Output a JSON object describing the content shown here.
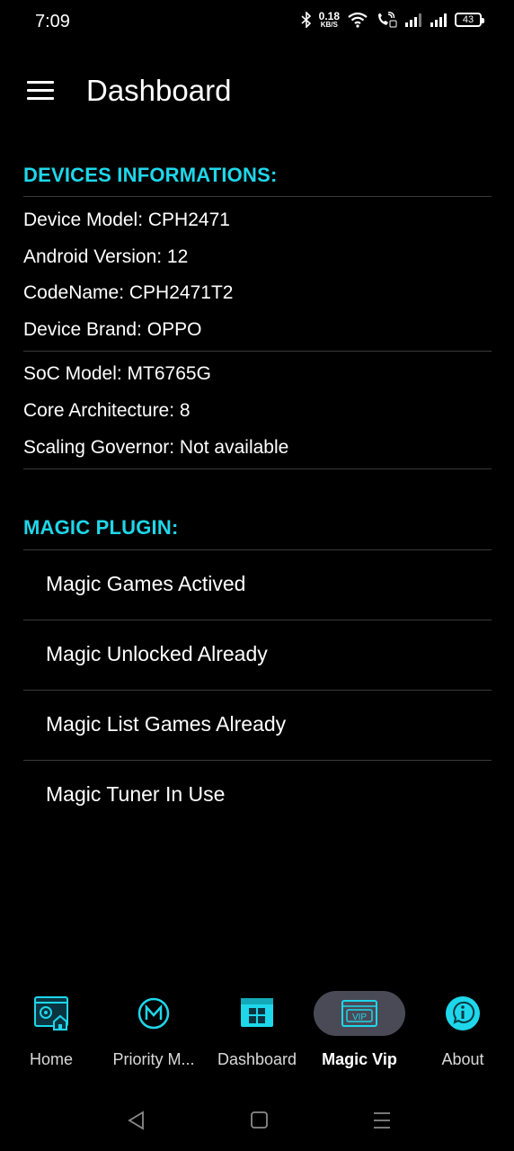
{
  "status_bar": {
    "time": "7:09",
    "net_speed_value": "0.18",
    "net_speed_unit": "KB/S",
    "battery": "43"
  },
  "app_bar": {
    "title": "Dashboard"
  },
  "devices": {
    "title": "DEVICES INFORMATIONS:",
    "rows": [
      "Device Model: CPH2471",
      "Android Version: 12",
      "CodeName: CPH2471T2",
      "Device Brand: OPPO",
      "SoC Model: MT6765G",
      "Core Architecture: 8",
      "Scaling Governor: Not available"
    ]
  },
  "magic_plugin": {
    "title": "MAGIC PLUGIN:",
    "items": [
      "Magic Games Actived",
      "Magic Unlocked Already",
      "Magic List Games Already",
      "Magic Tuner In Use"
    ]
  },
  "bottom_nav": {
    "items": [
      {
        "label": "Home",
        "icon": "settings-home-icon"
      },
      {
        "label": "Priority M...",
        "icon": "magic-m-icon"
      },
      {
        "label": "Dashboard",
        "icon": "dashboard-icon"
      },
      {
        "label": "Magic Vip",
        "icon": "vip-icon"
      },
      {
        "label": "About",
        "icon": "info-icon"
      }
    ],
    "active_index": 3
  },
  "colors": {
    "accent": "#1fd7ea",
    "background": "#000000",
    "pill": "#4a4a57"
  }
}
